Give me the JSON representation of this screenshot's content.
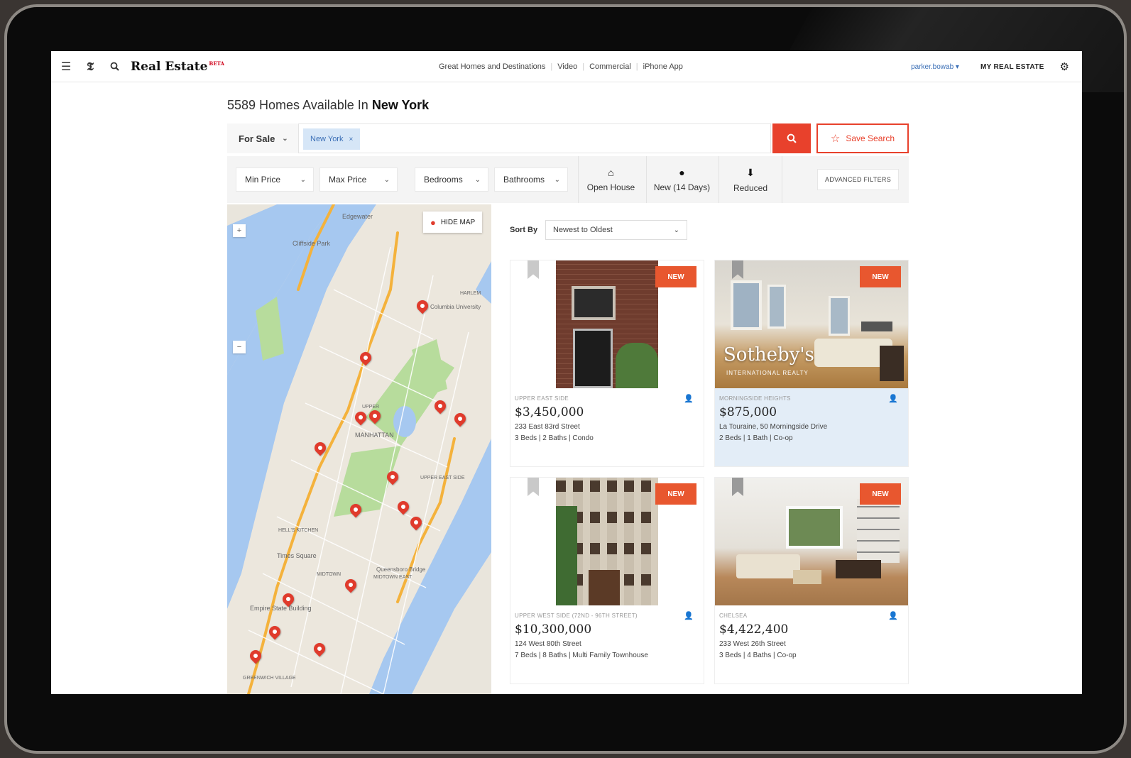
{
  "nav": {
    "menu_icon": "hamburger-icon",
    "logo_icon": "nyt-logo-icon",
    "search_icon": "search-icon",
    "brand": "Real Estate",
    "brand_badge": "BETA",
    "links": [
      "Great Homes and Destinations",
      "Video",
      "Commercial",
      "iPhone App"
    ],
    "username": "parker.bowab",
    "my_real_estate": "MY REAL ESTATE",
    "settings_icon": "gear-icon"
  },
  "heading": {
    "count_text": "5589 Homes Available In",
    "location": "New York"
  },
  "search": {
    "sale_type": "For Sale",
    "tag": "New York",
    "input_value": "",
    "save_label": "Save Search"
  },
  "filters": {
    "min_price": "Min Price",
    "max_price": "Max Price",
    "bedrooms": "Bedrooms",
    "bathrooms": "Bathrooms",
    "open_house": "Open House",
    "new_days": "New (14 Days)",
    "reduced": "Reduced",
    "advanced": "ADVANCED FILTERS"
  },
  "map": {
    "hide_label": "HIDE MAP",
    "labels": [
      "Edgewater",
      "Cliffside Park",
      "MANHATTAN",
      "UPPER EAST SIDE",
      "HELL'S KITCHEN",
      "Times Square",
      "Queensboro Bridge",
      "MIDTOWN EAST",
      "MIDTOWN",
      "Empire State Building",
      "GREENWICH VILLAGE",
      "UPPER",
      "Columbia University",
      "HARLEM"
    ]
  },
  "sort": {
    "label": "Sort By",
    "value": "Newest to Oldest"
  },
  "listings": [
    {
      "badge": "NEW",
      "neighborhood": "UPPER EAST SIDE",
      "price": "$3,450,000",
      "address": "233 East 83rd Street",
      "specs": "3 Beds | 2 Baths | Condo",
      "highlighted": false
    },
    {
      "badge": "NEW",
      "neighborhood": "MORNINGSIDE HEIGHTS",
      "price": "$875,000",
      "address": "La Touraine, 50 Morningside Drive",
      "specs": "2 Beds | 1 Bath | Co-op",
      "highlighted": true,
      "watermark": "Sotheby's",
      "watermark_sub": "INTERNATIONAL REALTY"
    },
    {
      "badge": "NEW",
      "neighborhood": "UPPER WEST SIDE (72ND - 96TH STREET)",
      "price": "$10,300,000",
      "address": "124 West 80th Street",
      "specs": "7 Beds | 8 Baths | Multi Family Townhouse",
      "highlighted": false
    },
    {
      "badge": "NEW",
      "neighborhood": "CHELSEA",
      "price": "$4,422,400",
      "address": "233 West 26th Street",
      "specs": "3 Beds | 4 Baths | Co-op",
      "highlighted": false
    }
  ]
}
